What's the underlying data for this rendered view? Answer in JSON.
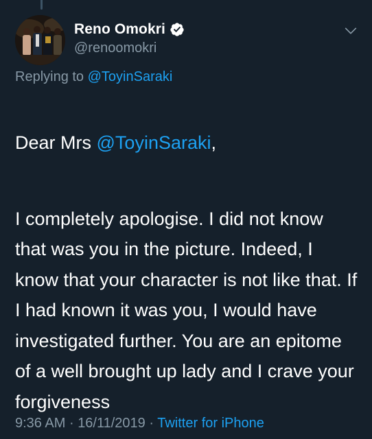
{
  "tweet": {
    "author": {
      "display_name": "Reno Omokri",
      "handle": "@renoomokri",
      "verified": true,
      "avatar_icon": "profile-photo"
    },
    "reply": {
      "prefix": "Replying to",
      "to": "@ToyinSaraki"
    },
    "greeting": {
      "prefix": "Dear Mrs ",
      "mention": "@ToyinSaraki",
      "suffix": ","
    },
    "text": "I completely apologise. I did not know that was you in the picture. Indeed, I know that your character is not like that. If I had known it was you, I would have investigated further. You are an epitome of a well brought up lady and I crave your forgiveness",
    "time": "9:36 AM",
    "separator": "·",
    "date": "16/11/2019",
    "source": "Twitter for iPhone"
  },
  "colors": {
    "background": "#15202b",
    "text": "#ffffff",
    "secondary": "#8899a6",
    "link": "#1da1f2"
  },
  "icons": {
    "verified": "verified-badge-icon",
    "more": "chevron-down-icon"
  }
}
